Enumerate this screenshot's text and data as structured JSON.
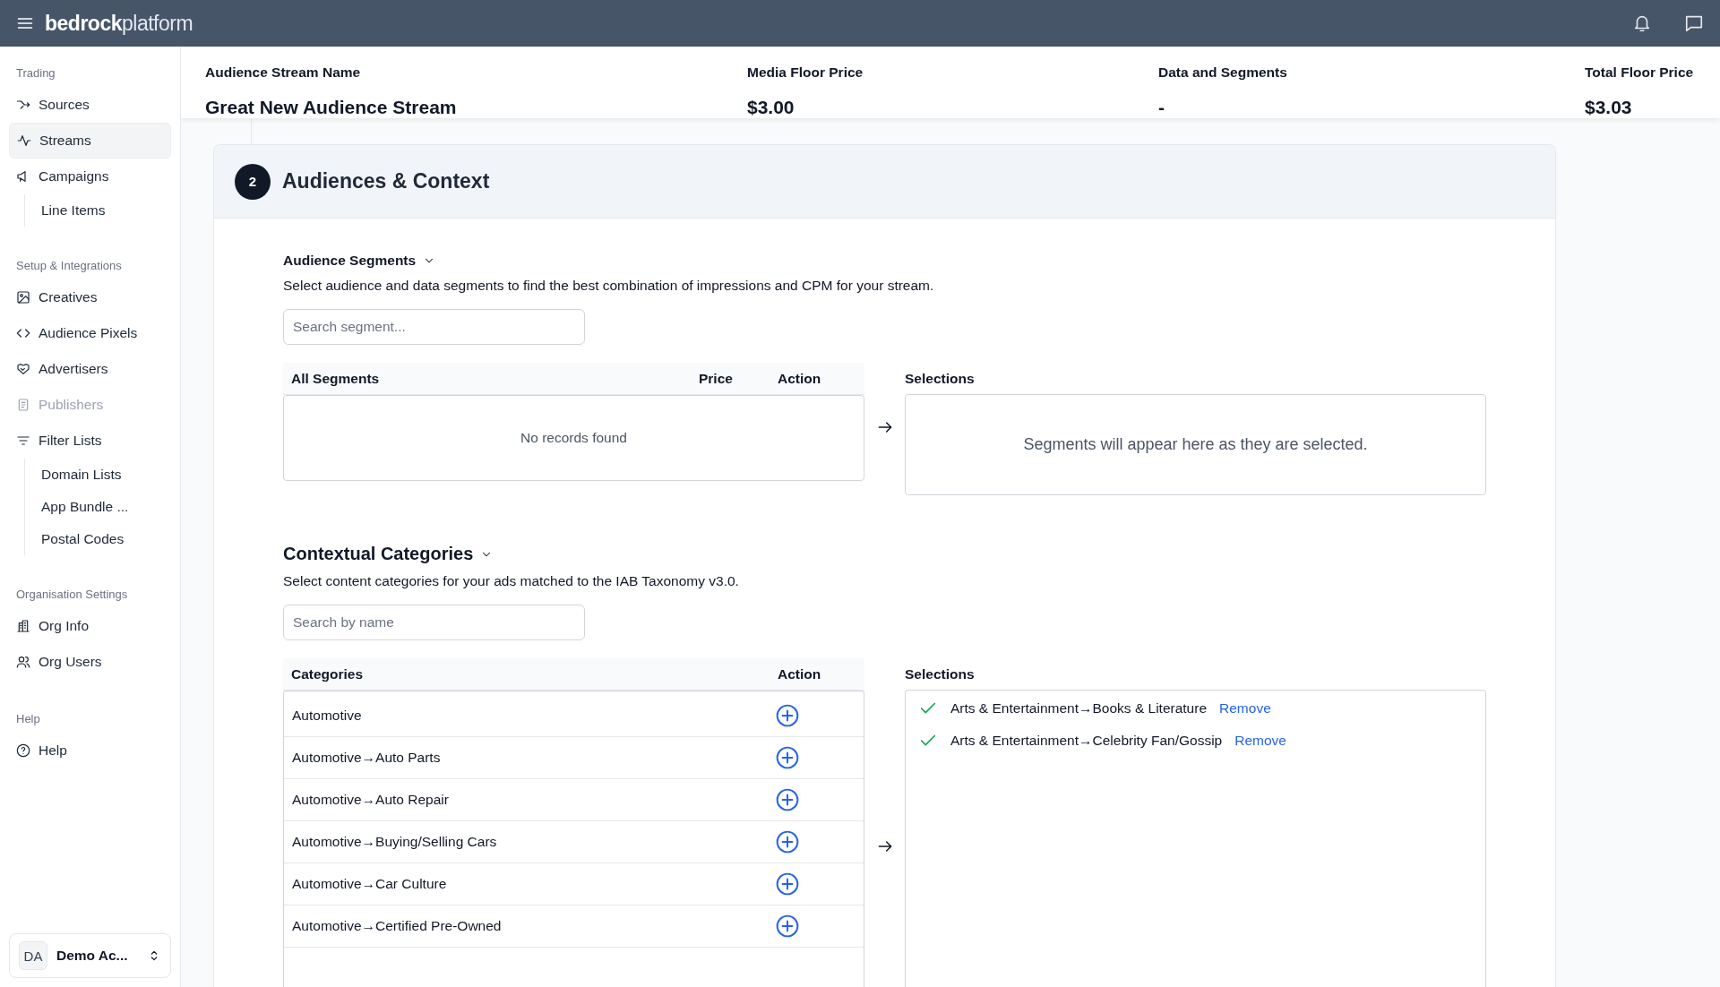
{
  "topbar": {
    "logo_bold": "bedrock",
    "logo_light": "platform"
  },
  "sidebar": {
    "sections": [
      {
        "heading": "Trading",
        "items": [
          {
            "label": "Sources",
            "kind": "sources",
            "selected": false,
            "disabled": false
          },
          {
            "label": "Streams",
            "kind": "streams",
            "selected": true,
            "disabled": false
          },
          {
            "label": "Campaigns",
            "kind": "campaigns",
            "selected": false,
            "disabled": false,
            "children": [
              {
                "label": "Line Items",
                "selected": false
              }
            ]
          }
        ]
      },
      {
        "heading": "Setup & Integrations",
        "items": [
          {
            "label": "Creatives",
            "kind": "creatives",
            "selected": false,
            "disabled": false
          },
          {
            "label": "Audience Pixels",
            "kind": "code",
            "selected": false,
            "disabled": false
          },
          {
            "label": "Advertisers",
            "kind": "handshake",
            "selected": false,
            "disabled": false
          },
          {
            "label": "Publishers",
            "kind": "document",
            "selected": false,
            "disabled": true
          },
          {
            "label": "Filter Lists",
            "kind": "filter",
            "selected": false,
            "disabled": false,
            "children": [
              {
                "label": "Domain Lists",
                "selected": false
              },
              {
                "label": "App Bundle ...",
                "selected": false
              },
              {
                "label": "Postal Codes",
                "selected": false
              }
            ]
          }
        ]
      },
      {
        "heading": "Organisation Settings",
        "items": [
          {
            "label": "Org Info",
            "kind": "building",
            "selected": false,
            "disabled": false
          },
          {
            "label": "Org Users",
            "kind": "users",
            "selected": false,
            "disabled": false
          }
        ]
      },
      {
        "heading": "Help",
        "items": [
          {
            "label": "Help",
            "kind": "help",
            "selected": false,
            "disabled": false
          }
        ]
      }
    ],
    "account": {
      "initials": "DA",
      "name": "Demo Ac..."
    }
  },
  "summary": [
    {
      "label": "Audience Stream Name",
      "value": "Great New Audience Stream"
    },
    {
      "label": "Media Floor Price",
      "value": "$3.00"
    },
    {
      "label": "Data and Segments",
      "value": "-"
    },
    {
      "label": "Total Floor Price",
      "value": "$3.03"
    }
  ],
  "step": {
    "number": "2",
    "title": "Audiences & Context"
  },
  "audience_segments": {
    "title": "Audience Segments",
    "expanded": true,
    "description": "Select audience and data segments to find the best combination of impressions and CPM for your stream.",
    "search_placeholder": "Search segment...",
    "columns": [
      "All Segments",
      "Price",
      "Action"
    ],
    "empty": "No records found",
    "selections_heading": "Selections",
    "selections_empty": "Segments will appear here as they are selected."
  },
  "contextual_categories": {
    "title": "Contextual Categories",
    "expanded": true,
    "description": "Select content categories for your ads matched to the IAB Taxonomy v3.0.",
    "search_placeholder": "Search by name",
    "columns": [
      "Categories",
      "Action"
    ],
    "rows": [
      {
        "label": "Automotive"
      },
      {
        "label": "Automotive→Auto Parts"
      },
      {
        "label": "Automotive→Auto Repair"
      },
      {
        "label": "Automotive→Buying/Selling Cars"
      },
      {
        "label": "Automotive→Car Culture"
      },
      {
        "label": "Automotive→Certified Pre-Owned"
      }
    ],
    "selections_heading": "Selections",
    "selections": [
      {
        "label": "Arts & Entertainment→Books & Literature",
        "action": "Remove"
      },
      {
        "label": "Arts & Entertainment→Celebrity Fan/Gossip",
        "action": "Remove"
      }
    ]
  }
}
